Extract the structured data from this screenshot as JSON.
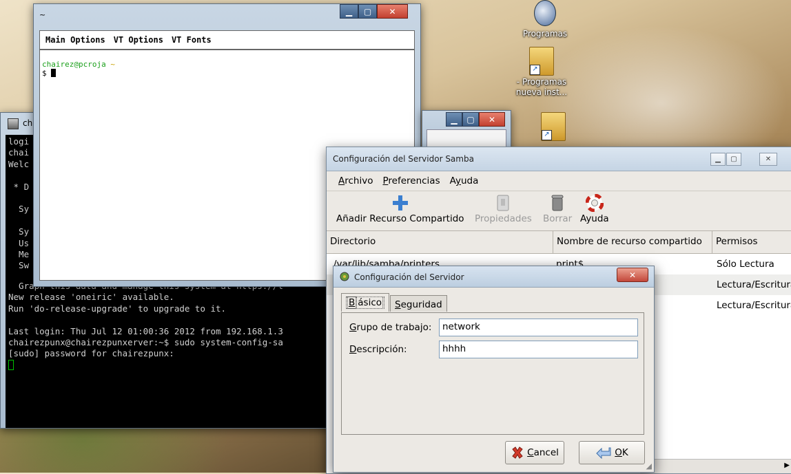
{
  "desktop": {
    "icons": [
      {
        "label": "Programas"
      },
      {
        "label": "- Programas nueva inst..."
      }
    ]
  },
  "back_terminal": {
    "title_fragment": "ch",
    "lines_left": [
      "logi",
      "chai",
      "Welc",
      "",
      " * D",
      "",
      "  Sy",
      "",
      "  Sy",
      "  Us",
      "  Me",
      "  Sw"
    ],
    "lines_full": [
      "  Graph this data and manage this system at https://l",
      "New release 'oneiric' available.",
      "Run 'do-release-upgrade' to upgrade to it.",
      "",
      "Last login: Thu Jul 12 01:00:36 2012 from 192.168.1.3",
      "chairezpunx@chairezpunxerver:~$ sudo system-config-sa",
      "[sudo] password for chairezpunx:"
    ]
  },
  "xterm": {
    "title": "~",
    "menu": [
      "Main Options",
      "VT Options",
      "VT Fonts"
    ],
    "prompt_user": "chairez@pcroja",
    "prompt_path": "~",
    "prompt_symbol": "$ "
  },
  "samba": {
    "title": "Configuración del Servidor Samba",
    "menu": [
      "Archivo",
      "Preferencias",
      "Ayuda"
    ],
    "toolbar": {
      "add": "Añadir Recurso Compartido",
      "properties": "Propiedades",
      "delete": "Borrar",
      "help": "Ayuda"
    },
    "columns": [
      "Directorio",
      "Nombre de recurso compartido",
      "Permisos"
    ],
    "rows": [
      {
        "dir": "/var/lib/samba/printers",
        "name": "print$",
        "perm": "Sólo Lectura"
      },
      {
        "dir": "",
        "name": "",
        "perm": "Lectura/Escritura"
      },
      {
        "dir": "",
        "name": "",
        "perm": "Lectura/Escritura"
      }
    ]
  },
  "dialog": {
    "title": "Configuración del Servidor",
    "tabs": [
      "Básico",
      "Seguridad"
    ],
    "workgroup_label": "Grupo de trabajo:",
    "workgroup_value": "network",
    "description_label": "Descripción:",
    "description_value": "hhhh",
    "cancel": "Cancel",
    "ok": "OK"
  },
  "colors": {
    "prompt_green": "#1a9f1a",
    "terminal_cursor": "#00c000"
  }
}
